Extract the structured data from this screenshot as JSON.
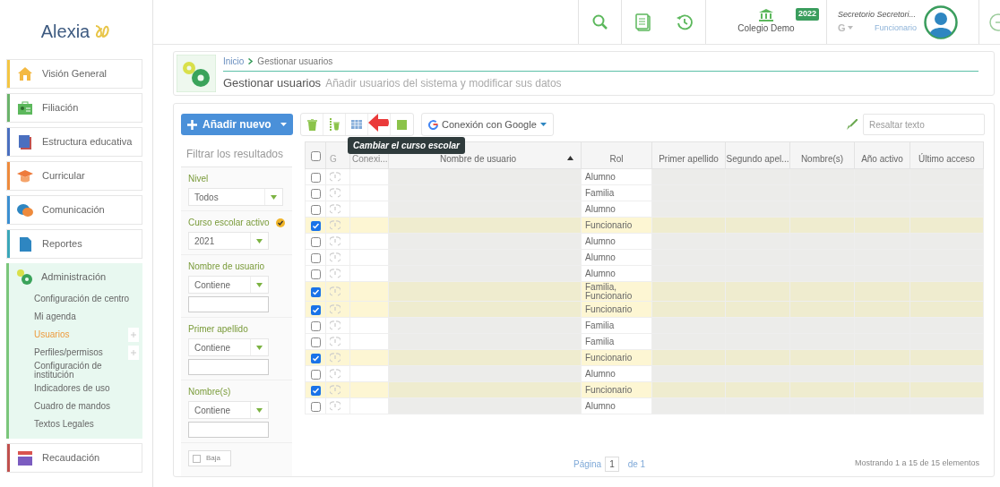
{
  "logo": {
    "text": "Alexia"
  },
  "topbar": {
    "school": "Colegio Demo",
    "year_badge": "2022",
    "user_name": "Secretorio Secretori...",
    "google_menu": "G",
    "user_role": "Funcionario"
  },
  "sidebar": {
    "items": [
      {
        "label": "Visión General",
        "color": "#f4c542",
        "expanded": false
      },
      {
        "label": "Filiación",
        "color": "#6bb36b",
        "expanded": false
      },
      {
        "label": "Estructura educativa",
        "color": "#4a6fbf",
        "expanded": false
      },
      {
        "label": "Curricular",
        "color": "#ee8a3c",
        "expanded": false
      },
      {
        "label": "Comunicación",
        "color": "#3b8fd1",
        "expanded": false
      },
      {
        "label": "Reportes",
        "color": "#3aa6b9",
        "expanded": false
      },
      {
        "label": "Administración",
        "color": "#7bc67b",
        "expanded": true,
        "children": [
          {
            "label": "Configuración de centro",
            "selected": false,
            "plus": false
          },
          {
            "label": "Mi agenda",
            "selected": false,
            "plus": false
          },
          {
            "label": "Usuarios",
            "selected": true,
            "plus": true
          },
          {
            "label": "Perfiles/permisos",
            "selected": false,
            "plus": true
          },
          {
            "label": "Configuración de institución",
            "selected": false,
            "plus": false
          },
          {
            "label": "Indicadores de uso",
            "selected": false,
            "plus": false
          },
          {
            "label": "Cuadro de mandos",
            "selected": false,
            "plus": false
          },
          {
            "label": "Textos Legales",
            "selected": false,
            "plus": false
          }
        ]
      },
      {
        "label": "Recaudación",
        "color": "#c0504d",
        "expanded": false
      }
    ]
  },
  "header": {
    "breadcrumb": [
      "Inicio",
      "Gestionar usuarios"
    ],
    "title": "Gestionar usuarios",
    "subtitle": "Añadir usuarios del sistema y modificar sus datos"
  },
  "toolbar": {
    "add_button": "Añadir nuevo",
    "google_button": "Conexión con Google",
    "tooltip": "Cambiar el curso escolar",
    "highlight_placeholder": "Resaltar texto"
  },
  "filters": {
    "title": "Filtrar los resultados",
    "groups": [
      {
        "kind": "select",
        "label": "Nivel",
        "value": "Todos",
        "badge": false
      },
      {
        "kind": "select",
        "label": "Curso escolar activo",
        "value": "2021",
        "badge": true
      },
      {
        "kind": "text",
        "label": "Nombre de usuario",
        "value": "Contiene",
        "badge": false
      },
      {
        "kind": "text",
        "label": "Primer apellido",
        "value": "Contiene",
        "badge": false
      },
      {
        "kind": "text",
        "label": "Nombre(s)",
        "value": "Contiene",
        "badge": false
      }
    ],
    "baja": {
      "label": "Baja",
      "checked": false
    }
  },
  "table": {
    "columns": [
      "G",
      "Conexi...",
      "Nombre de usuario",
      "Rol",
      "Primer apellido",
      "Segundo apel...",
      "Nombre(s)",
      "Año activo",
      "Último acceso"
    ],
    "select_all": false,
    "rows": [
      {
        "rol": "Alumno",
        "selected": false
      },
      {
        "rol": "Familia",
        "selected": false
      },
      {
        "rol": "Alumno",
        "selected": false
      },
      {
        "rol": "Funcionario",
        "selected": true
      },
      {
        "rol": "Alumno",
        "selected": false
      },
      {
        "rol": "Alumno",
        "selected": false
      },
      {
        "rol": "Alumno",
        "selected": false
      },
      {
        "rol": "Familia, Funcionario",
        "selected": true
      },
      {
        "rol": "Funcionario",
        "selected": true
      },
      {
        "rol": "Familia",
        "selected": false
      },
      {
        "rol": "Familia",
        "selected": false
      },
      {
        "rol": "Funcionario",
        "selected": true
      },
      {
        "rol": "Alumno",
        "selected": false
      },
      {
        "rol": "Funcionario",
        "selected": true
      },
      {
        "rol": "Alumno",
        "selected": false
      }
    ]
  },
  "pagination": {
    "page_label": "Página",
    "page": "1",
    "of": "de 1",
    "summary": "Mostrando 1 a 15 de 15 elementos"
  }
}
